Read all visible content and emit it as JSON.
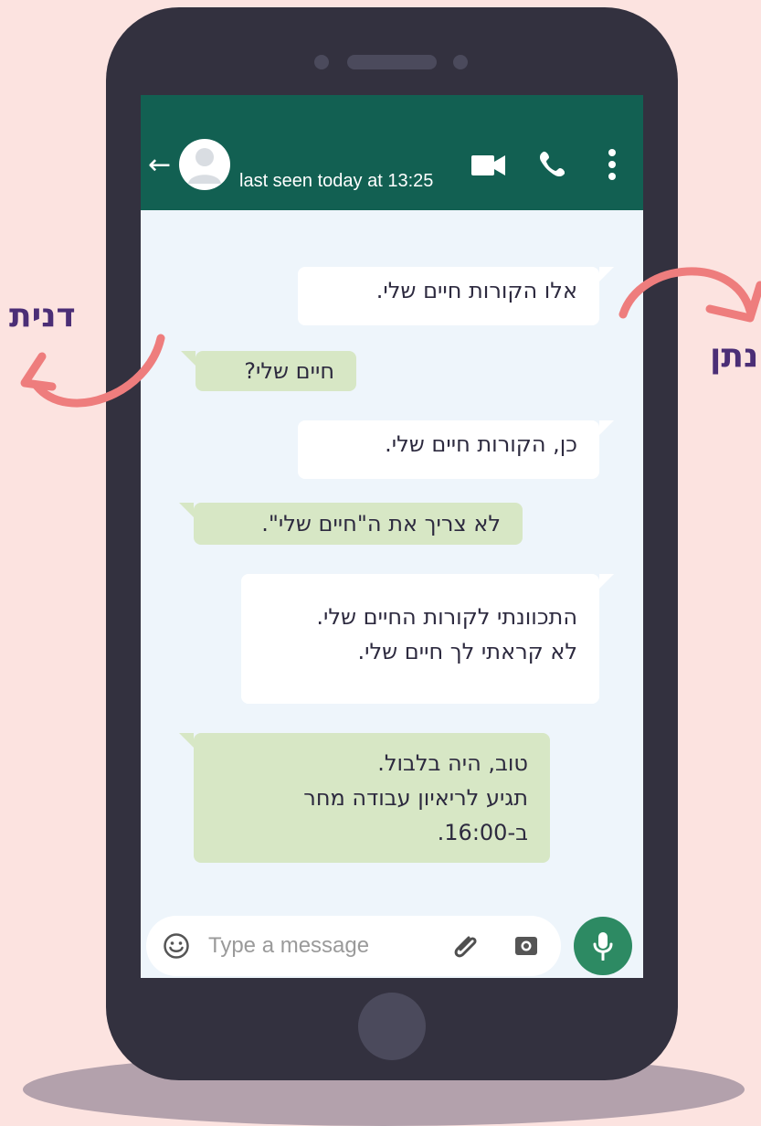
{
  "contact": {
    "last_seen": "last seen today at 13:25"
  },
  "messages": [
    {
      "text": "אלו הקורות חיים שלי."
    },
    {
      "text": "חיים שלי?"
    },
    {
      "text": "כן, הקורות חיים שלי."
    },
    {
      "text": "לא צריך את ה\"חיים שלי\"."
    },
    {
      "text": "התכוונתי לקורות החיים שלי.\nלא קראתי לך חיים שלי."
    },
    {
      "text": "טוב, היה בלבול.\nתגיע לריאיון עבודה מחר\nב-16:00."
    }
  ],
  "composer": {
    "placeholder": "Type a message"
  },
  "labels": {
    "left_name": "דנית",
    "right_name": "נתן"
  },
  "icons": {
    "back": "arrow-left-icon",
    "avatar": "avatar-icon",
    "video": "video-icon",
    "phone": "phone-icon",
    "more": "more-vertical-icon",
    "emoji": "emoji-icon",
    "attach": "paperclip-icon",
    "camera": "camera-icon",
    "mic": "microphone-icon"
  },
  "colors": {
    "background": "#FCE3E0",
    "phone_body": "#33313F",
    "header": "#126052",
    "chat_background": "#EEF5FB",
    "outgoing_bubble": "#FFFFFF",
    "incoming_bubble": "#D7E7C5",
    "mic_button": "#2D8A63",
    "name_text": "#4B2E76",
    "arrow": "#EE7D7D"
  }
}
